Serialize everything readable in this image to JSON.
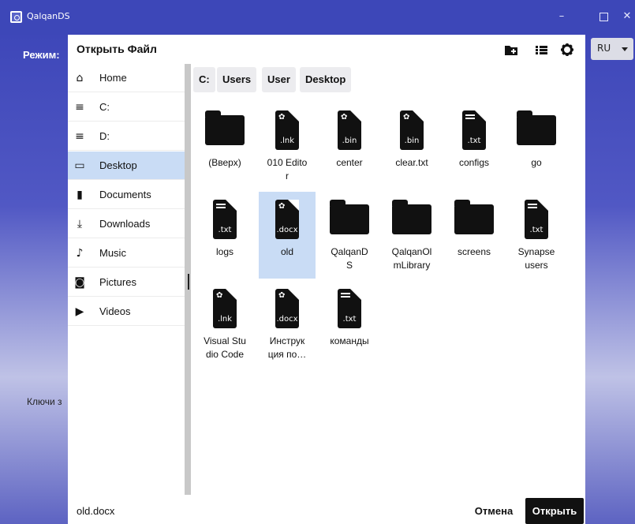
{
  "app": {
    "title": "QalqanDS",
    "mode_label": "Режим:",
    "keys_label": "Ключи з",
    "language": "RU",
    "window_controls": {
      "minimize": "–"
    }
  },
  "dialog": {
    "title": "Открыть Файл",
    "toolbar_icons": [
      "new-folder-icon",
      "list-view-icon",
      "gear-icon"
    ],
    "sidebar": [
      {
        "label": "Home",
        "icon": "home-icon",
        "glyph": "⌂"
      },
      {
        "label": "C:",
        "icon": "drive-icon",
        "glyph": "≡"
      },
      {
        "label": "D:",
        "icon": "drive-icon",
        "glyph": "≡"
      },
      {
        "label": "Desktop",
        "icon": "desktop-icon",
        "glyph": "▭"
      },
      {
        "label": "Documents",
        "icon": "document-icon",
        "glyph": "▮"
      },
      {
        "label": "Downloads",
        "icon": "download-icon",
        "glyph": "⤓"
      },
      {
        "label": "Music",
        "icon": "music-icon",
        "glyph": "♪"
      },
      {
        "label": "Pictures",
        "icon": "camera-icon",
        "glyph": "◙"
      },
      {
        "label": "Videos",
        "icon": "video-icon",
        "glyph": "▶"
      }
    ],
    "sidebar_active": "Desktop",
    "breadcrumb": [
      "C:",
      "Users",
      "User",
      "Desktop"
    ],
    "files": [
      {
        "name": "(Вверх)",
        "kind": "folder"
      },
      {
        "name": "010 Edito\nr",
        "kind": "file",
        "ext": ".lnk",
        "style": "gear"
      },
      {
        "name": "center",
        "kind": "file",
        "ext": ".bin",
        "style": "gear"
      },
      {
        "name": "clear.txt",
        "kind": "file",
        "ext": ".bin",
        "style": "gear"
      },
      {
        "name": "configs",
        "kind": "file",
        "ext": ".txt",
        "style": "lines"
      },
      {
        "name": "go",
        "kind": "folder"
      },
      {
        "name": "logs",
        "kind": "file",
        "ext": ".txt",
        "style": "lines"
      },
      {
        "name": "old",
        "kind": "file",
        "ext": ".docx",
        "style": "gear",
        "selected": true
      },
      {
        "name": "QalqanD\nS",
        "kind": "folder"
      },
      {
        "name": "QalqanOl\nmLibrary",
        "kind": "folder"
      },
      {
        "name": "screens",
        "kind": "folder"
      },
      {
        "name": "Synapse\nusers",
        "kind": "file",
        "ext": ".txt",
        "style": "lines"
      },
      {
        "name": "Visual Stu\ndio Code",
        "kind": "file",
        "ext": ".lnk",
        "style": "gear"
      },
      {
        "name": "Инструк\nция по…",
        "kind": "file",
        "ext": ".docx",
        "style": "gear"
      },
      {
        "name": "команды",
        "kind": "file",
        "ext": ".txt",
        "style": "lines"
      }
    ],
    "selected_file": "old.docx",
    "cancel_label": "Отмена",
    "open_label": "Открыть"
  }
}
